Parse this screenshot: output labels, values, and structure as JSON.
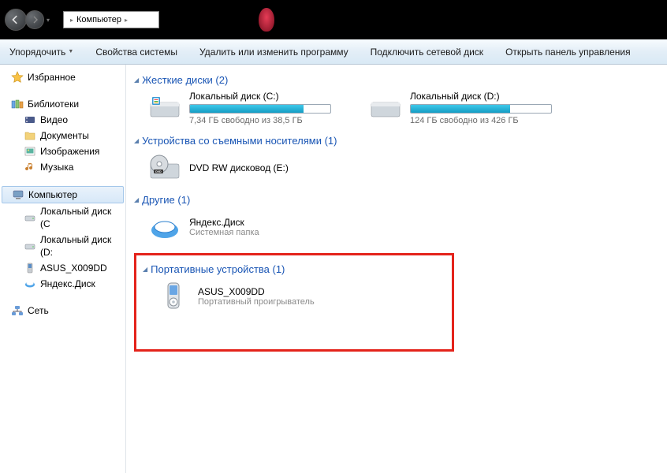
{
  "titlebar": {
    "breadcrumb": "Компьютер",
    "sep": "▸"
  },
  "toolbar": {
    "organize": "Упорядочить",
    "props": "Свойства системы",
    "uninstall": "Удалить или изменить программу",
    "mapdrive": "Подключить сетевой диск",
    "ctrlpanel": "Открыть панель управления"
  },
  "sidebar": {
    "favorites": "Избранное",
    "libraries": "Библиотеки",
    "lib_items": {
      "video": "Видео",
      "docs": "Документы",
      "pics": "Изображения",
      "music": "Музыка"
    },
    "computer": "Компьютер",
    "comp_items": {
      "c": "Локальный диск (C",
      "d": "Локальный диск (D:",
      "asus": "ASUS_X009DD",
      "yadisk": "Яндекс.Диск"
    },
    "network": "Сеть"
  },
  "groups": {
    "hdd": {
      "title": "Жесткие диски (2)",
      "items": [
        {
          "name": "Локальный диск (C:)",
          "free": "7,34 ГБ свободно из 38,5 ГБ",
          "fill": 81
        },
        {
          "name": "Локальный диск (D:)",
          "free": "124 ГБ свободно из 426 ГБ",
          "fill": 71
        }
      ]
    },
    "removable": {
      "title": "Устройства со съемными носителями (1)",
      "items": [
        {
          "name": "DVD RW дисковод (E:)"
        }
      ]
    },
    "other": {
      "title": "Другие (1)",
      "items": [
        {
          "name": "Яндекс.Диск",
          "sub": "Системная папка"
        }
      ]
    },
    "portable": {
      "title": "Портативные устройства (1)",
      "items": [
        {
          "name": "ASUS_X009DD",
          "sub": "Портативный проигрыватель"
        }
      ]
    }
  }
}
